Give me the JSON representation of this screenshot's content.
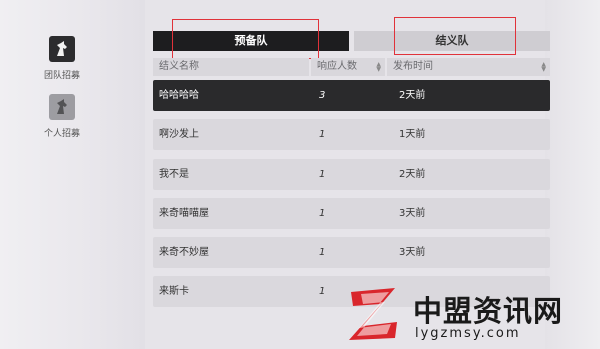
{
  "sidebar": {
    "items": [
      {
        "label": "团队招募",
        "icon": "horse-head-icon",
        "active": true
      },
      {
        "label": "个人招募",
        "icon": "horse-head-icon",
        "active": false
      }
    ]
  },
  "tabs": [
    {
      "label": "预备队",
      "active": true
    },
    {
      "label": "结义队",
      "active": false
    }
  ],
  "table": {
    "headers": [
      "结义名称",
      "响应人数",
      "发布时间"
    ],
    "rows": [
      {
        "name": "哈哈哈哈",
        "count": "3",
        "time": "2天前",
        "selected": true
      },
      {
        "name": "啊沙发上",
        "count": "1",
        "time": "1天前",
        "selected": false
      },
      {
        "name": "我不是",
        "count": "1",
        "time": "2天前",
        "selected": false
      },
      {
        "name": "来奇喵喵屋",
        "count": "1",
        "time": "3天前",
        "selected": false
      },
      {
        "name": "来奇不妙屋",
        "count": "1",
        "time": "3天前",
        "selected": false
      },
      {
        "name": "来斯卡",
        "count": "1",
        "time": "",
        "selected": false
      }
    ]
  },
  "watermark": {
    "title": "中盟资讯网",
    "url": "lygzmsy.com",
    "icon": "z-logo-icon"
  },
  "colors": {
    "accent_dark": "#1d1d1f",
    "highlight_red": "#e0323a",
    "logo_red": "#d9262c"
  }
}
